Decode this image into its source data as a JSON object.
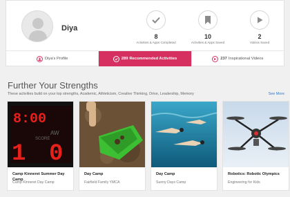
{
  "profile": {
    "name": "Diya"
  },
  "stats": [
    {
      "count": "8",
      "label": "Activities & Apps Completed",
      "icon": "check-icon"
    },
    {
      "count": "10",
      "label": "Activities & Apps Saved",
      "icon": "bookmark-icon"
    },
    {
      "count": "2",
      "label": "Videos Saved",
      "icon": "play-icon"
    }
  ],
  "tabs": [
    {
      "count": "",
      "label": "Diya's Profile",
      "icon": "profile-icon"
    },
    {
      "count": "289",
      "label": "Recommended Activities",
      "icon": "recommended-icon"
    },
    {
      "count": "237",
      "label": "Inspirational Videos",
      "icon": "video-icon"
    }
  ],
  "strengths": {
    "title": "Further Your Strengths",
    "subtitle": "These activities build on your top strengths, Academic, Athleticism, Creative Thinking, Drive, Leadership, Memory",
    "see_more": "See More"
  },
  "cards": [
    {
      "title": "Camp Kinneret Summer Day Camp",
      "org": "Camp Kinneret Day Camp",
      "image": "scoreboard"
    },
    {
      "title": "Day Camp",
      "org": "Fairfield Family YMCA",
      "image": "gardening"
    },
    {
      "title": "Day Camp",
      "org": "Sunny Days Camp",
      "image": "swimming"
    },
    {
      "title": "Robotics: Robotic Olympics",
      "org": "Engineering for Kids",
      "image": "drone"
    }
  ],
  "colors": {
    "accent": "#d63060",
    "link": "#2a7bd0"
  }
}
